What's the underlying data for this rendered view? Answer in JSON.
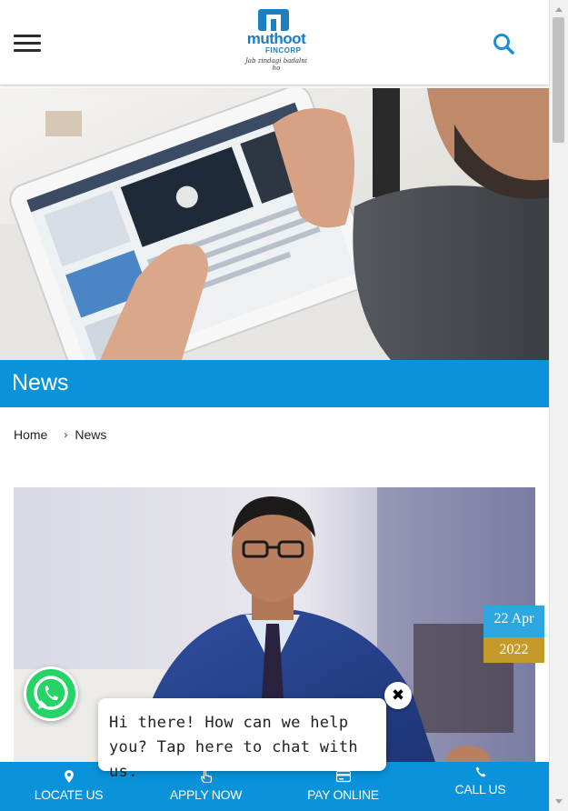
{
  "header": {
    "logo": {
      "brand": "muthoot",
      "sub": "FINCORP",
      "tagline": "Jab zindagi badalni ho"
    },
    "menu_icon": "hamburger-menu-icon",
    "search_icon": "search-icon"
  },
  "page": {
    "title": "News"
  },
  "breadcrumb": {
    "home": "Home",
    "current": "News"
  },
  "article": {
    "date_day": "22 Apr",
    "date_year": "2022"
  },
  "chat": {
    "message": "Hi there! How can we help you? Tap here to chat with us.",
    "close_symbol": "✖"
  },
  "bottom_nav": {
    "items": [
      {
        "label": "LOCATE US",
        "icon": "location-pin-icon"
      },
      {
        "label": "APPLY NOW",
        "icon": "hand-pointer-icon"
      },
      {
        "label": "PAY ONLINE",
        "icon": "credit-card-icon"
      },
      {
        "label": "CALL US",
        "icon": "phone-icon"
      }
    ]
  },
  "colors": {
    "primary_blue": "#0a93db",
    "date_blue": "#2ea7e0",
    "date_gold": "#c49a2b",
    "whatsapp_green": "#25d366"
  }
}
